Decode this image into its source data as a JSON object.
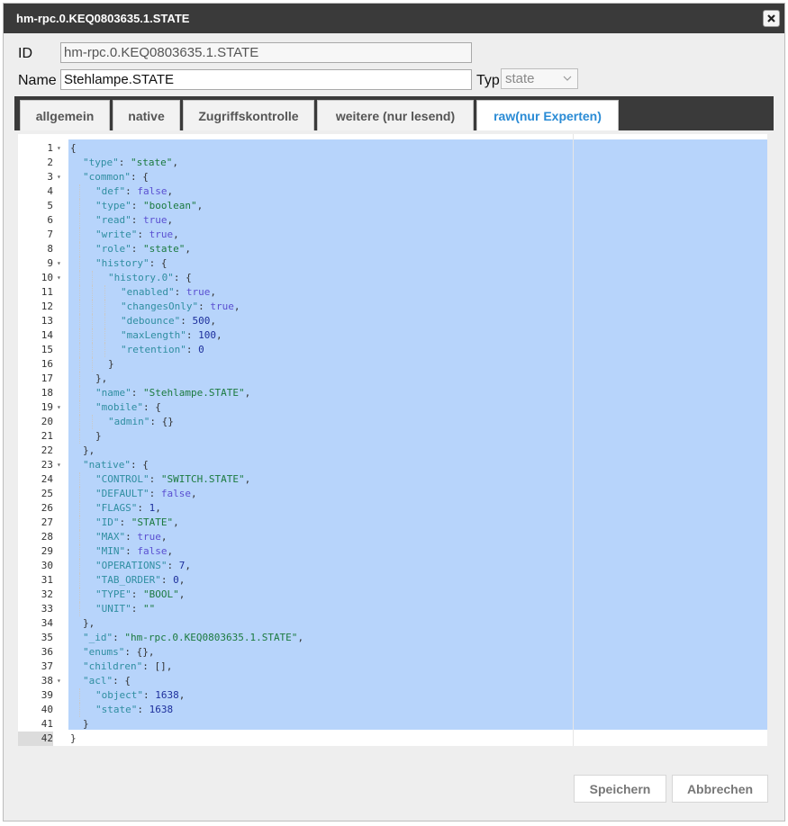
{
  "dialog": {
    "title": "hm-rpc.0.KEQ0803635.1.STATE",
    "close_icon": "close-icon"
  },
  "form": {
    "id_label": "ID",
    "id_value": "hm-rpc.0.KEQ0803635.1.STATE",
    "name_label": "Name",
    "name_value": "Stehlampe.STATE",
    "typ_label": "Typ",
    "typ_value": "state"
  },
  "tabs": [
    {
      "label": "allgemein",
      "active": false
    },
    {
      "label": "native",
      "active": false
    },
    {
      "label": "Zugriffskontrolle",
      "active": false
    },
    {
      "label": "weitere (nur lesend)",
      "active": false
    },
    {
      "label": "raw(nur Experten)",
      "active": true
    }
  ],
  "editor": {
    "current_line": 42,
    "lines": [
      {
        "n": 1,
        "fold": true,
        "indent": 0,
        "t": [
          [
            "p",
            "{"
          ]
        ]
      },
      {
        "n": 2,
        "fold": false,
        "indent": 1,
        "t": [
          [
            "k",
            "\"type\""
          ],
          [
            "p",
            ": "
          ],
          [
            "s",
            "\"state\""
          ],
          [
            "p",
            ","
          ]
        ]
      },
      {
        "n": 3,
        "fold": true,
        "indent": 1,
        "t": [
          [
            "k",
            "\"common\""
          ],
          [
            "p",
            ": {"
          ]
        ]
      },
      {
        "n": 4,
        "fold": false,
        "indent": 2,
        "t": [
          [
            "k",
            "\"def\""
          ],
          [
            "p",
            ": "
          ],
          [
            "b",
            "false"
          ],
          [
            "p",
            ","
          ]
        ]
      },
      {
        "n": 5,
        "fold": false,
        "indent": 2,
        "t": [
          [
            "k",
            "\"type\""
          ],
          [
            "p",
            ": "
          ],
          [
            "s",
            "\"boolean\""
          ],
          [
            "p",
            ","
          ]
        ]
      },
      {
        "n": 6,
        "fold": false,
        "indent": 2,
        "t": [
          [
            "k",
            "\"read\""
          ],
          [
            "p",
            ": "
          ],
          [
            "b",
            "true"
          ],
          [
            "p",
            ","
          ]
        ]
      },
      {
        "n": 7,
        "fold": false,
        "indent": 2,
        "t": [
          [
            "k",
            "\"write\""
          ],
          [
            "p",
            ": "
          ],
          [
            "b",
            "true"
          ],
          [
            "p",
            ","
          ]
        ]
      },
      {
        "n": 8,
        "fold": false,
        "indent": 2,
        "t": [
          [
            "k",
            "\"role\""
          ],
          [
            "p",
            ": "
          ],
          [
            "s",
            "\"state\""
          ],
          [
            "p",
            ","
          ]
        ]
      },
      {
        "n": 9,
        "fold": true,
        "indent": 2,
        "t": [
          [
            "k",
            "\"history\""
          ],
          [
            "p",
            ": {"
          ]
        ]
      },
      {
        "n": 10,
        "fold": true,
        "indent": 3,
        "t": [
          [
            "k",
            "\"history.0\""
          ],
          [
            "p",
            ": {"
          ]
        ]
      },
      {
        "n": 11,
        "fold": false,
        "indent": 4,
        "t": [
          [
            "k",
            "\"enabled\""
          ],
          [
            "p",
            ": "
          ],
          [
            "b",
            "true"
          ],
          [
            "p",
            ","
          ]
        ]
      },
      {
        "n": 12,
        "fold": false,
        "indent": 4,
        "t": [
          [
            "k",
            "\"changesOnly\""
          ],
          [
            "p",
            ": "
          ],
          [
            "b",
            "true"
          ],
          [
            "p",
            ","
          ]
        ]
      },
      {
        "n": 13,
        "fold": false,
        "indent": 4,
        "t": [
          [
            "k",
            "\"debounce\""
          ],
          [
            "p",
            ": "
          ],
          [
            "n",
            "500"
          ],
          [
            "p",
            ","
          ]
        ]
      },
      {
        "n": 14,
        "fold": false,
        "indent": 4,
        "t": [
          [
            "k",
            "\"maxLength\""
          ],
          [
            "p",
            ": "
          ],
          [
            "n",
            "100"
          ],
          [
            "p",
            ","
          ]
        ]
      },
      {
        "n": 15,
        "fold": false,
        "indent": 4,
        "t": [
          [
            "k",
            "\"retention\""
          ],
          [
            "p",
            ": "
          ],
          [
            "n",
            "0"
          ]
        ]
      },
      {
        "n": 16,
        "fold": false,
        "indent": 3,
        "t": [
          [
            "p",
            "}"
          ]
        ]
      },
      {
        "n": 17,
        "fold": false,
        "indent": 2,
        "t": [
          [
            "p",
            "},"
          ]
        ]
      },
      {
        "n": 18,
        "fold": false,
        "indent": 2,
        "t": [
          [
            "k",
            "\"name\""
          ],
          [
            "p",
            ": "
          ],
          [
            "s",
            "\"Stehlampe.STATE\""
          ],
          [
            "p",
            ","
          ]
        ]
      },
      {
        "n": 19,
        "fold": true,
        "indent": 2,
        "t": [
          [
            "k",
            "\"mobile\""
          ],
          [
            "p",
            ": {"
          ]
        ]
      },
      {
        "n": 20,
        "fold": false,
        "indent": 3,
        "t": [
          [
            "k",
            "\"admin\""
          ],
          [
            "p",
            ": {}"
          ]
        ]
      },
      {
        "n": 21,
        "fold": false,
        "indent": 2,
        "t": [
          [
            "p",
            "}"
          ]
        ]
      },
      {
        "n": 22,
        "fold": false,
        "indent": 1,
        "t": [
          [
            "p",
            "},"
          ]
        ]
      },
      {
        "n": 23,
        "fold": true,
        "indent": 1,
        "t": [
          [
            "k",
            "\"native\""
          ],
          [
            "p",
            ": {"
          ]
        ]
      },
      {
        "n": 24,
        "fold": false,
        "indent": 2,
        "t": [
          [
            "k",
            "\"CONTROL\""
          ],
          [
            "p",
            ": "
          ],
          [
            "s",
            "\"SWITCH.STATE\""
          ],
          [
            "p",
            ","
          ]
        ]
      },
      {
        "n": 25,
        "fold": false,
        "indent": 2,
        "t": [
          [
            "k",
            "\"DEFAULT\""
          ],
          [
            "p",
            ": "
          ],
          [
            "b",
            "false"
          ],
          [
            "p",
            ","
          ]
        ]
      },
      {
        "n": 26,
        "fold": false,
        "indent": 2,
        "t": [
          [
            "k",
            "\"FLAGS\""
          ],
          [
            "p",
            ": "
          ],
          [
            "n",
            "1"
          ],
          [
            "p",
            ","
          ]
        ]
      },
      {
        "n": 27,
        "fold": false,
        "indent": 2,
        "t": [
          [
            "k",
            "\"ID\""
          ],
          [
            "p",
            ": "
          ],
          [
            "s",
            "\"STATE\""
          ],
          [
            "p",
            ","
          ]
        ]
      },
      {
        "n": 28,
        "fold": false,
        "indent": 2,
        "t": [
          [
            "k",
            "\"MAX\""
          ],
          [
            "p",
            ": "
          ],
          [
            "b",
            "true"
          ],
          [
            "p",
            ","
          ]
        ]
      },
      {
        "n": 29,
        "fold": false,
        "indent": 2,
        "t": [
          [
            "k",
            "\"MIN\""
          ],
          [
            "p",
            ": "
          ],
          [
            "b",
            "false"
          ],
          [
            "p",
            ","
          ]
        ]
      },
      {
        "n": 30,
        "fold": false,
        "indent": 2,
        "t": [
          [
            "k",
            "\"OPERATIONS\""
          ],
          [
            "p",
            ": "
          ],
          [
            "n",
            "7"
          ],
          [
            "p",
            ","
          ]
        ]
      },
      {
        "n": 31,
        "fold": false,
        "indent": 2,
        "t": [
          [
            "k",
            "\"TAB_ORDER\""
          ],
          [
            "p",
            ": "
          ],
          [
            "n",
            "0"
          ],
          [
            "p",
            ","
          ]
        ]
      },
      {
        "n": 32,
        "fold": false,
        "indent": 2,
        "t": [
          [
            "k",
            "\"TYPE\""
          ],
          [
            "p",
            ": "
          ],
          [
            "s",
            "\"BOOL\""
          ],
          [
            "p",
            ","
          ]
        ]
      },
      {
        "n": 33,
        "fold": false,
        "indent": 2,
        "t": [
          [
            "k",
            "\"UNIT\""
          ],
          [
            "p",
            ": "
          ],
          [
            "s",
            "\"\""
          ]
        ]
      },
      {
        "n": 34,
        "fold": false,
        "indent": 1,
        "t": [
          [
            "p",
            "},"
          ]
        ]
      },
      {
        "n": 35,
        "fold": false,
        "indent": 1,
        "t": [
          [
            "k",
            "\"_id\""
          ],
          [
            "p",
            ": "
          ],
          [
            "s",
            "\"hm-rpc.0.KEQ0803635.1.STATE\""
          ],
          [
            "p",
            ","
          ]
        ]
      },
      {
        "n": 36,
        "fold": false,
        "indent": 1,
        "t": [
          [
            "k",
            "\"enums\""
          ],
          [
            "p",
            ": {},"
          ]
        ]
      },
      {
        "n": 37,
        "fold": false,
        "indent": 1,
        "t": [
          [
            "k",
            "\"children\""
          ],
          [
            "p",
            ": [],"
          ]
        ]
      },
      {
        "n": 38,
        "fold": true,
        "indent": 1,
        "t": [
          [
            "k",
            "\"acl\""
          ],
          [
            "p",
            ": {"
          ]
        ]
      },
      {
        "n": 39,
        "fold": false,
        "indent": 2,
        "t": [
          [
            "k",
            "\"object\""
          ],
          [
            "p",
            ": "
          ],
          [
            "n",
            "1638"
          ],
          [
            "p",
            ","
          ]
        ]
      },
      {
        "n": 40,
        "fold": false,
        "indent": 2,
        "t": [
          [
            "k",
            "\"state\""
          ],
          [
            "p",
            ": "
          ],
          [
            "n",
            "1638"
          ]
        ]
      },
      {
        "n": 41,
        "fold": false,
        "indent": 1,
        "t": [
          [
            "p",
            "}"
          ]
        ]
      },
      {
        "n": 42,
        "fold": false,
        "indent": 0,
        "t": [
          [
            "p",
            "}"
          ]
        ]
      }
    ]
  },
  "footer": {
    "save_label": "Speichern",
    "cancel_label": "Abbrechen"
  }
}
